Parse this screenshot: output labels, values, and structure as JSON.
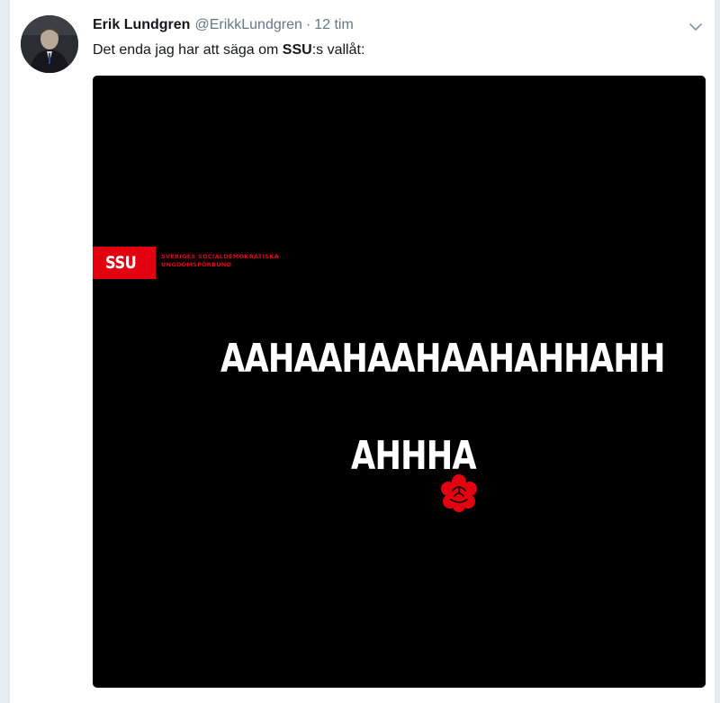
{
  "tweet": {
    "display_name": "Erik Lundgren",
    "handle": "@ErikkLundgren",
    "separator": "·",
    "time": "12 tim",
    "text_before": "Det enda jag har att säga om ",
    "text_bold": "SSU",
    "text_after": ":s vallåt:",
    "caret_icon": "chevron-down-icon",
    "avatar_icon": "profile-photo"
  },
  "media": {
    "logo_text": "SSU",
    "tagline_line1": "SVERIGES SOCIALDEMOKRATISKA",
    "tagline_line2": "UNGDOMSFÖRBUND",
    "line1": "AAHAAHAAHAAHAHHAHH",
    "line2": "AHHHA",
    "rose_icon": "red-rose-icon",
    "brand_color": "#e3000f"
  }
}
